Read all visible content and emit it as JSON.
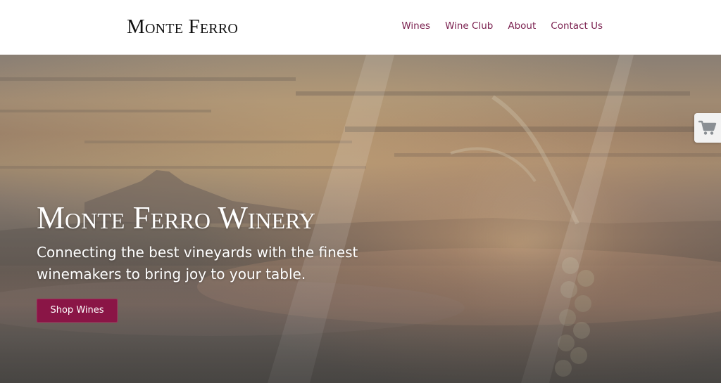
{
  "header": {
    "logo": "Monte Ferro",
    "nav": [
      "Wines",
      "Wine Club",
      "About",
      "Contact Us"
    ]
  },
  "hero": {
    "title": "Monte Ferro Winery",
    "subtitle": "Connecting the best vineyards with the finest winemakers to bring joy to your table.",
    "cta_label": "Shop Wines",
    "background_image": "misty sunrise over mountains and valley with grape clusters overlay"
  },
  "cart_tab": {
    "icon": "cart-icon"
  },
  "colors": {
    "nav_link": "#7a1f4e",
    "cta_background": "#8a1546",
    "logo": "#111111",
    "hero_text": "#ffffff"
  }
}
